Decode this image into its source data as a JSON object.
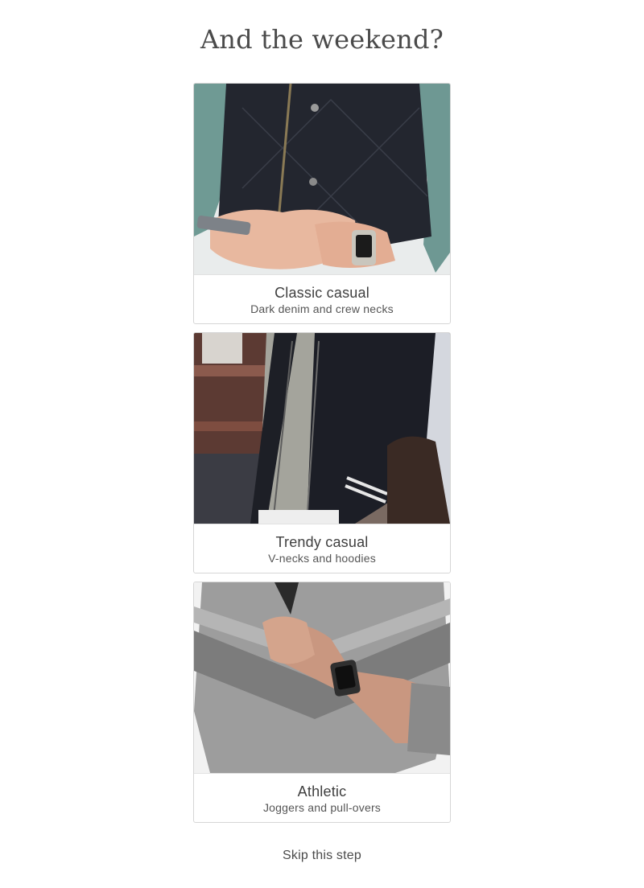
{
  "header": {
    "title": "And the weekend?"
  },
  "options": [
    {
      "title": "Classic casual",
      "subtitle": "Dark denim and crew necks",
      "image_icon": "man-in-quilted-vest-with-phone-and-smartwatch-photo"
    },
    {
      "title": "Trendy casual",
      "subtitle": "V-necks and hoodies",
      "image_icon": "man-in-black-bomber-jacket-with-leather-bag-photo"
    },
    {
      "title": "Athletic",
      "subtitle": "Joggers and pull-overs",
      "image_icon": "man-in-grey-athletic-pullover-with-smartwatch-photo"
    }
  ],
  "footer": {
    "skip_label": "Skip this step"
  },
  "colors": {
    "title_text": "#4a4a4a",
    "card_border": "#d6d6d6",
    "background": "#ffffff"
  }
}
